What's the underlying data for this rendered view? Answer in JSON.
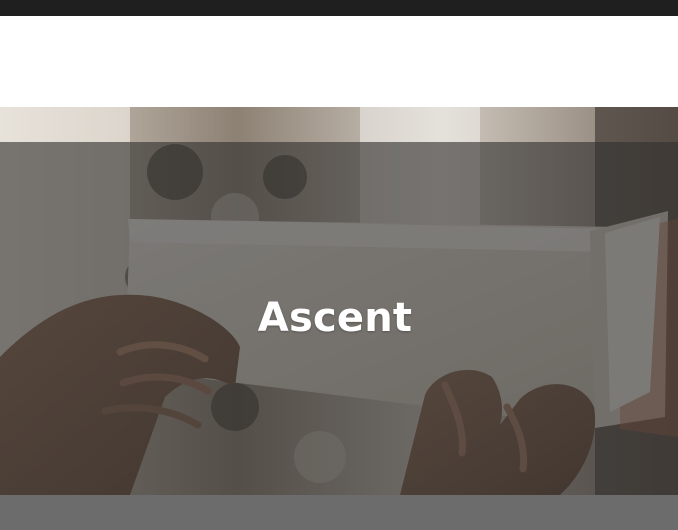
{
  "hero": {
    "title": "Ascent",
    "image_icon": "book-reading-photo"
  },
  "colors": {
    "top_bar": "#1f1f1f",
    "header_background": "#ffffff",
    "hero_overlay": "#32302e",
    "title_text": "#ffffff",
    "bottom_bar": "#6c6c6c"
  }
}
